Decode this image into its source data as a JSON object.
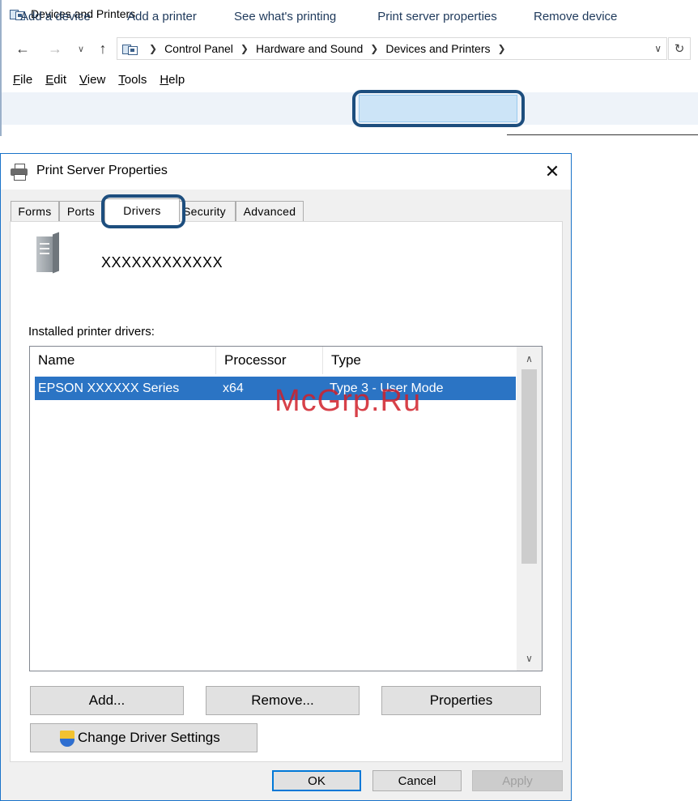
{
  "explorer": {
    "title": "Devices and Printers",
    "address": {
      "crumbs": [
        "Control Panel",
        "Hardware and Sound",
        "Devices and Printers"
      ]
    },
    "menu": [
      "File",
      "Edit",
      "View",
      "Tools",
      "Help"
    ],
    "commands": {
      "add_device": "Add a device",
      "add_printer": "Add a printer",
      "see_printing": "See what's printing",
      "print_server_properties": "Print server properties",
      "remove_device": "Remove device"
    }
  },
  "dialog": {
    "title": "Print Server Properties",
    "tabs": {
      "forms": "Forms",
      "ports": "Ports",
      "drivers": "Drivers",
      "security": "Security",
      "advanced": "Advanced"
    },
    "active_tab": "Drivers",
    "server_name": "XXXXXXXXXXXX",
    "installed_label": "Installed printer drivers:",
    "list": {
      "columns": {
        "name": "Name",
        "processor": "Processor",
        "type": "Type"
      },
      "rows": [
        {
          "name": "EPSON XXXXXX Series",
          "processor": "x64",
          "type": "Type 3 - User Mode",
          "selected": true
        }
      ]
    },
    "buttons": {
      "add": "Add...",
      "remove": "Remove...",
      "properties": "Properties",
      "change_driver_settings": "Change Driver Settings",
      "ok": "OK",
      "cancel": "Cancel",
      "apply": "Apply"
    }
  },
  "watermark": "McGrp.Ru",
  "colors": {
    "highlight_ring": "#1d4e7e",
    "selection": "#2b74c4",
    "command_bar": "#eef3f9",
    "watermark": "#d1202a"
  },
  "icons": [
    "control-panel-icon",
    "back-arrow-icon",
    "forward-arrow-icon",
    "up-arrow-icon",
    "refresh-icon",
    "printer-icon",
    "close-icon",
    "server-icon",
    "uac-shield-icon",
    "scroll-up-icon",
    "scroll-down-icon"
  ]
}
